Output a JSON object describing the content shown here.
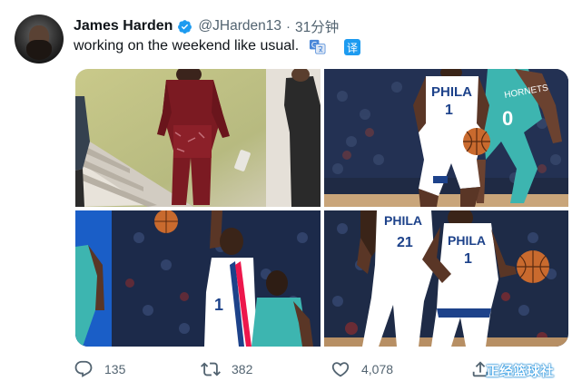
{
  "tweet": {
    "author_name": "James Harden",
    "handle": "@JHarden13",
    "separator": "·",
    "time": "31分钟",
    "text": "working on the weekend like usual.",
    "translate_label": "译",
    "verified": true
  },
  "media": {
    "photos": [
      {
        "label": "photo-arrival"
      },
      {
        "label": "photo-dribble-vs-hornets"
      },
      {
        "label": "photo-jumper"
      },
      {
        "label": "photo-handoff-21-1"
      }
    ],
    "jerseys": {
      "p2_player": "1",
      "p2_defender": "0",
      "p4_player_left": "21",
      "p4_player_right": "1",
      "team_text": "PHILA",
      "hornets_text": "HORNETS"
    }
  },
  "actions": {
    "replies": "135",
    "retweets": "382",
    "likes": "4,078"
  },
  "watermark": "正经篮球社",
  "colors": {
    "accent": "#1d9bf0",
    "text": "#0f1419",
    "secondary": "#536471",
    "sixers_blue": "#1d428a",
    "sixers_red": "#ed174c",
    "hornets_teal": "#3db5b0"
  }
}
